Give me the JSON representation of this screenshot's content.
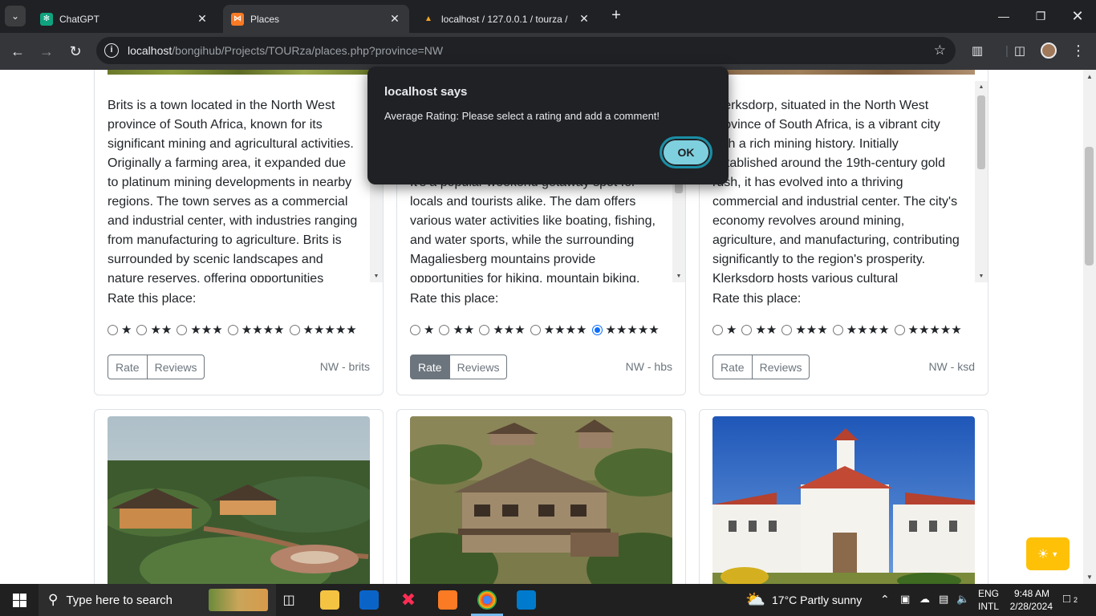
{
  "browser": {
    "tabs": [
      {
        "title": "ChatGPT",
        "active": false
      },
      {
        "title": "Places",
        "active": true
      },
      {
        "title": "localhost / 127.0.0.1 / tourza / ",
        "active": false
      }
    ],
    "url_host": "localhost",
    "url_path": "/bongihub/Projects/TOURza/places.php?province=NW"
  },
  "alert": {
    "title": "localhost says",
    "message": "Average Rating: Please select a rating and add a comment!",
    "ok_label": "OK"
  },
  "rate_label": "Rate this place:",
  "rating_options": [
    "★",
    "★★",
    "★★★",
    "★★★★",
    "★★★★★"
  ],
  "rate_button": "Rate",
  "reviews_button": "Reviews",
  "cards": [
    {
      "code": "NW - brits",
      "description": "Brits is a town located in the North West province of South Africa, known for its significant mining and agricultural activities. Originally a farming area, it expanded due to platinum mining developments in nearby regions. The town serves as a commercial and industrial center, with industries ranging from manufacturing to agriculture. Brits is surrounded by scenic landscapes and nature reserves, offering opportunities",
      "selected_rating": null,
      "rate_active": false
    },
    {
      "code": "NW - hbs",
      "description": "It's a popular weekend getaway spot for locals and tourists alike. The dam offers various water activities like boating, fishing, and water sports, while the surrounding Magaliesberg mountains provide opportunities for hiking, mountain biking,",
      "selected_rating": 5,
      "rate_active": true
    },
    {
      "code": "NW - ksd",
      "description": "Klerksdorp, situated in the North West province of South Africa, is a vibrant city with a rich mining history. Initially established around the 19th-century gold rush, it has evolved into a thriving commercial and industrial center. The city's economy revolves around mining, agriculture, and manufacturing, contributing significantly to the region's prosperity. Klerksdorp hosts various cultural",
      "selected_rating": null,
      "rate_active": false
    }
  ],
  "taskbar": {
    "search_placeholder": "Type here to search",
    "weather": "17°C  Partly sunny",
    "lang_top": "ENG",
    "lang_bottom": "INTL",
    "time": "9:48 AM",
    "date": "2/28/2024",
    "notifications": "2"
  },
  "colors": {
    "accent_yellow": "#ffc107",
    "ok_button": "#7fd0df",
    "active_button": "#6c757d"
  }
}
